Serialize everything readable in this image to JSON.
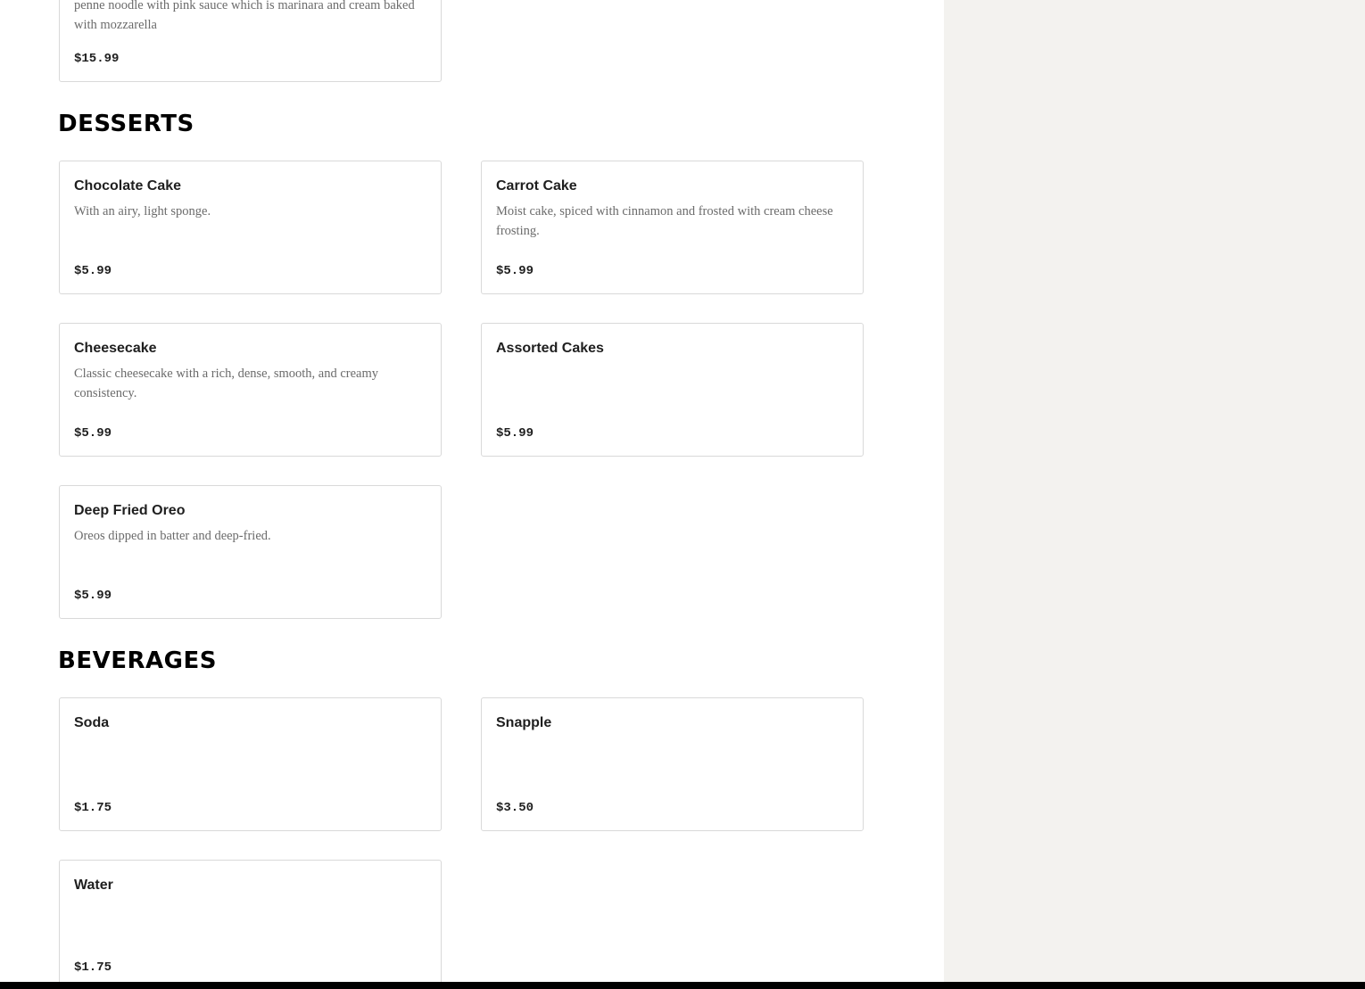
{
  "partial_item": {
    "description": "penne noodle with pink sauce which is marinara and cream baked with mozzarella",
    "price": "$15.99"
  },
  "sections": {
    "desserts": {
      "title": "DESSERTS",
      "items": [
        {
          "name": "Chocolate Cake",
          "description": "With an airy, light sponge.",
          "price": "$5.99"
        },
        {
          "name": "Carrot Cake",
          "description": "Moist cake, spiced with cinnamon and frosted with cream cheese frosting.",
          "price": "$5.99"
        },
        {
          "name": "Cheesecake",
          "description": "Classic cheesecake with a rich, dense, smooth, and creamy consistency.",
          "price": "$5.99"
        },
        {
          "name": "Assorted Cakes",
          "description": "",
          "price": "$5.99"
        },
        {
          "name": "Deep Fried Oreo",
          "description": "Oreos dipped in batter and deep-fried.",
          "price": "$5.99"
        }
      ]
    },
    "beverages": {
      "title": "BEVERAGES",
      "items": [
        {
          "name": "Soda",
          "description": "",
          "price": "$1.75"
        },
        {
          "name": "Snapple",
          "description": "",
          "price": "$3.50"
        },
        {
          "name": "Water",
          "description": "",
          "price": "$1.75"
        }
      ]
    }
  }
}
